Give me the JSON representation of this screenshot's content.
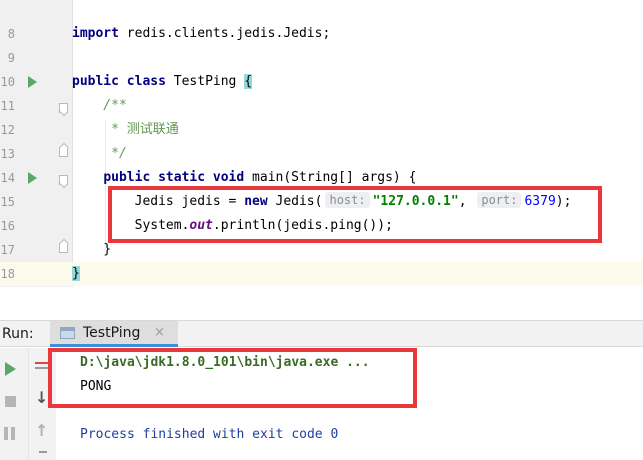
{
  "editor": {
    "lines": [
      {
        "number": "8",
        "tokens": [
          {
            "t": "import",
            "c": "kw-plain"
          },
          {
            "t": " redis.clients.jedis.Jedis;",
            "c": "plain"
          }
        ]
      },
      {
        "number": "9",
        "tokens": []
      },
      {
        "number": "10",
        "tokens": [
          {
            "t": "public",
            "c": "kw"
          },
          {
            "t": " ",
            "c": "plain"
          },
          {
            "t": "class",
            "c": "kw"
          },
          {
            "t": " TestPing ",
            "c": "plain"
          },
          {
            "t": "{",
            "c": "brace"
          }
        ]
      },
      {
        "number": "11",
        "tokens": [
          {
            "t": "    /**",
            "c": "cmt"
          }
        ]
      },
      {
        "number": "12",
        "tokens": [
          {
            "t": "     * ",
            "c": "cmt"
          },
          {
            "t": "测试联通",
            "c": "cmt-cn"
          }
        ]
      },
      {
        "number": "13",
        "tokens": [
          {
            "t": "     */",
            "c": "cmt"
          }
        ]
      },
      {
        "number": "14",
        "tokens": [
          {
            "t": "    ",
            "c": "plain"
          },
          {
            "t": "public",
            "c": "kw"
          },
          {
            "t": " ",
            "c": "plain"
          },
          {
            "t": "static",
            "c": "kw"
          },
          {
            "t": " ",
            "c": "plain"
          },
          {
            "t": "void",
            "c": "kw"
          },
          {
            "t": " main(String[] args) {",
            "c": "plain"
          }
        ]
      },
      {
        "number": "15",
        "tokens": [
          {
            "t": "        Jedis jedis = ",
            "c": "plain"
          },
          {
            "t": "new",
            "c": "kw"
          },
          {
            "t": " Jedis(",
            "c": "plain"
          },
          {
            "t": "host:",
            "c": "hint"
          },
          {
            "t": "\"127.0.0.1\"",
            "c": "str"
          },
          {
            "t": ", ",
            "c": "plain"
          },
          {
            "t": "port:",
            "c": "hint"
          },
          {
            "t": "6379",
            "c": "num"
          },
          {
            "t": ");",
            "c": "plain"
          }
        ]
      },
      {
        "number": "16",
        "tokens": [
          {
            "t": "        System.",
            "c": "plain"
          },
          {
            "t": "out",
            "c": "fld"
          },
          {
            "t": ".println(jedis.ping());",
            "c": "plain"
          }
        ]
      },
      {
        "number": "17",
        "tokens": [
          {
            "t": "    }",
            "c": "plain"
          }
        ]
      },
      {
        "number": "18",
        "tokens": [
          {
            "t": "}",
            "c": "brace"
          }
        ]
      }
    ]
  },
  "run_panel": {
    "label": "Run:",
    "tab_label": "TestPing",
    "tab_close": "×",
    "output": {
      "command": "D:\\java\\jdk1.8.0_101\\bin\\java.exe ...",
      "result": "PONG",
      "exit": "Process finished with exit code 0"
    },
    "toolbar_icons": [
      "run-icon",
      "stop-icon",
      "pause-icon",
      "scroll-to-end-icon",
      "down-arrow-icon",
      "up-arrow-icon"
    ]
  },
  "colors": {
    "annotation_red": "#e8383b",
    "run_green": "#59a869",
    "tab_underline": "#3c8fda",
    "keyword": "#000080",
    "string": "#008000",
    "number": "#0000ff"
  }
}
